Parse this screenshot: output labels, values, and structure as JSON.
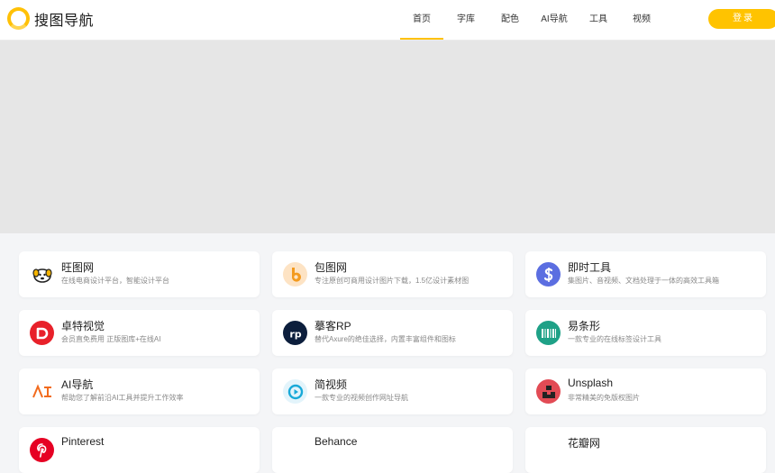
{
  "header": {
    "logo_text": "搜图导航",
    "nav": [
      {
        "label": "首页",
        "active": true
      },
      {
        "label": "字库",
        "active": false
      },
      {
        "label": "配色",
        "active": false
      },
      {
        "label": "AI导航",
        "active": false
      },
      {
        "label": "工具",
        "active": false
      },
      {
        "label": "视频",
        "active": false
      }
    ],
    "login_label": "登录"
  },
  "cards": [
    {
      "title": "旺图网",
      "desc": "在线电商设计平台，智能设计平台",
      "icon": "dog-face-icon",
      "color": "#ffffff"
    },
    {
      "title": "包图网",
      "desc": "专注原创可商用设计图片下载，1.5亿设计素材图",
      "icon": "b-letter-icon",
      "color": "#f9a23b"
    },
    {
      "title": "即时工具",
      "desc": "集图片、音视频、文档处理于一体的高效工具箱",
      "icon": "dollar-s-icon",
      "color": "#5b6ee1"
    },
    {
      "title": "卓特视觉",
      "desc": "会员直免费用 正版图库+在线AI",
      "icon": "d-letter-icon",
      "color": "#e8212a"
    },
    {
      "title": "摹客RP",
      "desc": "替代Axure的绝佳选择，内置丰富组件和图标",
      "icon": "rp-icon",
      "color": "#0c1e3c"
    },
    {
      "title": "易条形",
      "desc": "一款专业的在线标签设计工具",
      "icon": "barcode-icon",
      "color": "#1fa187"
    },
    {
      "title": "AI导航",
      "desc": "帮助您了解前沿AI工具并提升工作效率",
      "icon": "ai-letters-icon",
      "color": "#ffffff"
    },
    {
      "title": "简视频",
      "desc": "一款专业的视频创作网址导航",
      "icon": "play-icon",
      "color": "#e3f4fb"
    },
    {
      "title": "Unsplash",
      "desc": "非常精美的免版权图片",
      "icon": "camera-icon",
      "color": "#e24b55"
    },
    {
      "title": "Pinterest",
      "desc": "",
      "icon": "pinterest-icon",
      "color": "#e60023"
    },
    {
      "title": "Behance",
      "desc": "",
      "icon": "behance-icon",
      "color": "#ffffff"
    },
    {
      "title": "花瓣网",
      "desc": "",
      "icon": "flower-icon",
      "color": "#ffffff"
    }
  ]
}
